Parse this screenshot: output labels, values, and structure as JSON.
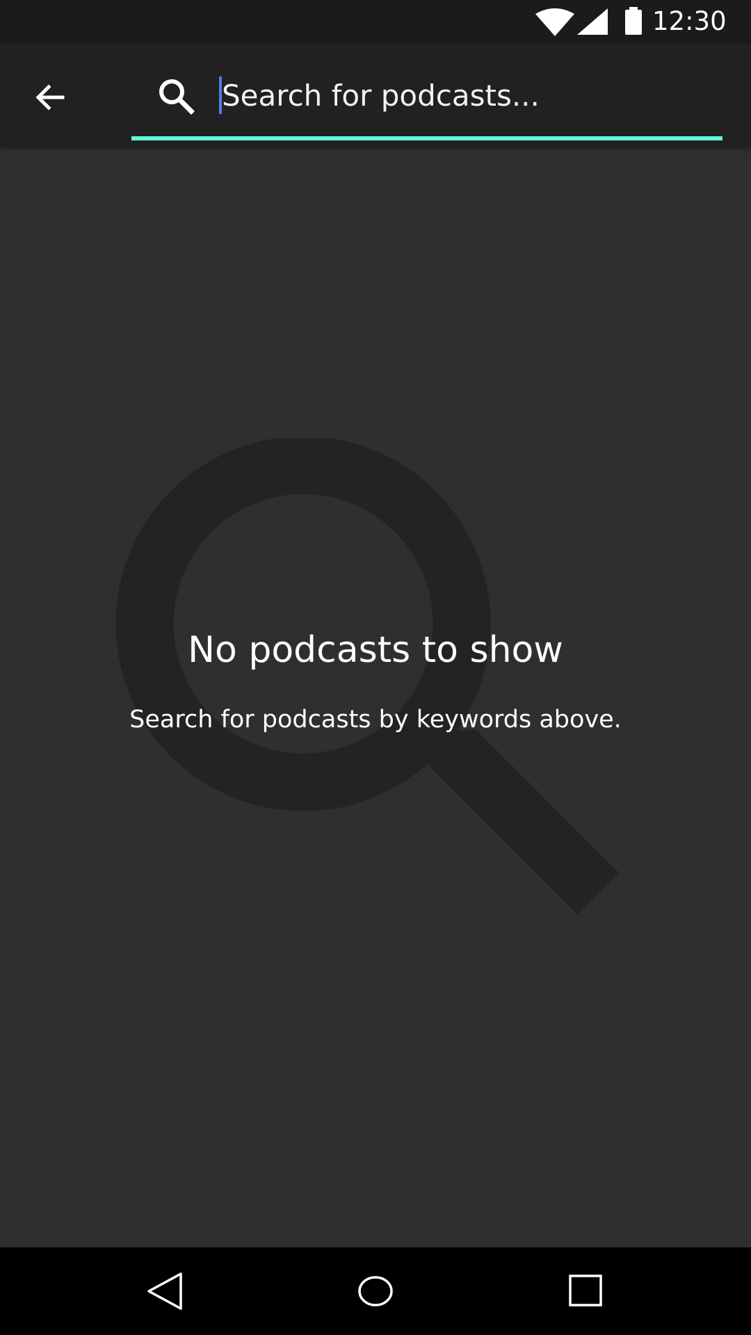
{
  "status_bar": {
    "time": "12:30",
    "icons": [
      "wifi-icon",
      "signal-icon",
      "battery-icon"
    ]
  },
  "toolbar": {
    "back_icon": "arrow-left-icon",
    "search_icon": "search-icon",
    "search_placeholder": "Search for podcasts...",
    "search_value": ""
  },
  "empty_state": {
    "icon": "search-icon",
    "title": "No podcasts to show",
    "subtitle": "Search for podcasts by keywords above."
  },
  "nav_bar": {
    "buttons": [
      "back-triangle-icon",
      "home-circle-icon",
      "recents-square-icon"
    ]
  },
  "colors": {
    "status_bar_bg": "#1b1b1b",
    "toolbar_bg": "#212121",
    "content_bg": "#2f2f2f",
    "accent_underline": "#64ffda",
    "caret": "#4f7fe8",
    "empty_icon": "#232323",
    "nav_bar_bg": "#000000"
  }
}
